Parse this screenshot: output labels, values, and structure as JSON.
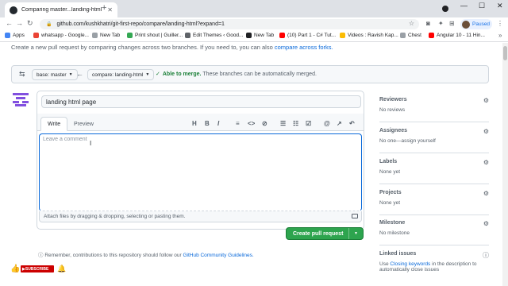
{
  "browser": {
    "tab_title": "Comparing master...landing-html",
    "url": "github.com/kushkhatri/git-first-repo/compare/landing-html?expand=1",
    "profile_status": "Paused",
    "bookmarks": [
      {
        "label": "Apps",
        "color": "#4285f4"
      },
      {
        "label": "whatsapp - Google...",
        "color": "#ea4335"
      },
      {
        "label": "New Tab",
        "color": "#9aa0a6"
      },
      {
        "label": "Print shout | Guiller...",
        "color": "#34a853"
      },
      {
        "label": "Edit Themes ‹ Good...",
        "color": "#5f6368"
      },
      {
        "label": "New Tab",
        "color": "#202124"
      },
      {
        "label": "(10) Part 1 - C# Tut...",
        "color": "#ff0000"
      },
      {
        "label": "Videos : Ravish Kap...",
        "color": "#fbbc04"
      },
      {
        "label": "Chest",
        "color": "#9aa0a6"
      },
      {
        "label": "Angular 10 - 11 Hin...",
        "color": "#ff0000"
      }
    ]
  },
  "page": {
    "intro_text": "Create a new pull request by comparing changes across two branches. If you need to, you can also ",
    "intro_link": "compare across forks.",
    "base_branch": "base: master",
    "compare_branch": "compare: landing-html",
    "merge_status": "Able to merge.",
    "merge_desc": "These branches can be automatically merged.",
    "pr_title": "landing html page",
    "tabs": [
      "Write",
      "Preview"
    ],
    "toolbar_icons": [
      "H",
      "B",
      "I"
    ],
    "comment_placeholder": "Leave a comment",
    "attach_text": "Attach files by dragging & dropping, selecting or pasting them.",
    "create_button": "Create pull request",
    "remember_text": "Remember, contributions to this repository should follow our ",
    "remember_link": "GitHub Community Guidelines.",
    "subscribe_label": "SUBSCRIBE"
  },
  "sidebar": {
    "reviewers": {
      "title": "Reviewers",
      "value": "No reviews"
    },
    "assignees": {
      "title": "Assignees",
      "value": "No one—assign yourself"
    },
    "labels": {
      "title": "Labels",
      "value": "None yet"
    },
    "projects": {
      "title": "Projects",
      "value": "None yet"
    },
    "milestone": {
      "title": "Milestone",
      "value": "No milestone"
    },
    "linked_issues": {
      "title": "Linked issues",
      "prefix": "Use ",
      "link": "Closing keywords",
      "suffix": " in the description to automatically close issues"
    }
  },
  "colors": {
    "accent": "#0969da",
    "merge_green": "#1a7f37",
    "button_green": "#2da44e"
  }
}
